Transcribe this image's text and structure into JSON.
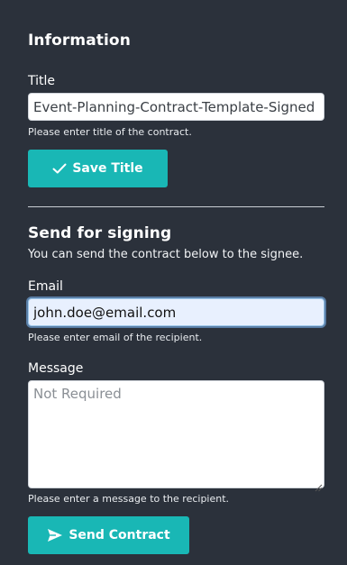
{
  "information": {
    "heading": "Information",
    "title_label": "Title",
    "title_value": "Event-Planning-Contract-Template-Signed",
    "title_help": "Please enter title of the contract.",
    "save_button_label": "Save Title"
  },
  "signing": {
    "heading": "Send for signing",
    "subtitle": "You can send the contract below to the signee.",
    "email_label": "Email",
    "email_value": "john.doe@email.com",
    "email_help": "Please enter email of the recipient.",
    "message_label": "Message",
    "message_placeholder": "Not Required",
    "message_help": "Please enter a message to the recipient.",
    "send_button_label": "Send Contract"
  },
  "icons": {
    "save": "check-icon",
    "send": "paper-plane-icon"
  },
  "colors": {
    "background": "#2b313b",
    "accent": "#19b7b5",
    "focus_fill": "#e8f0fe"
  }
}
